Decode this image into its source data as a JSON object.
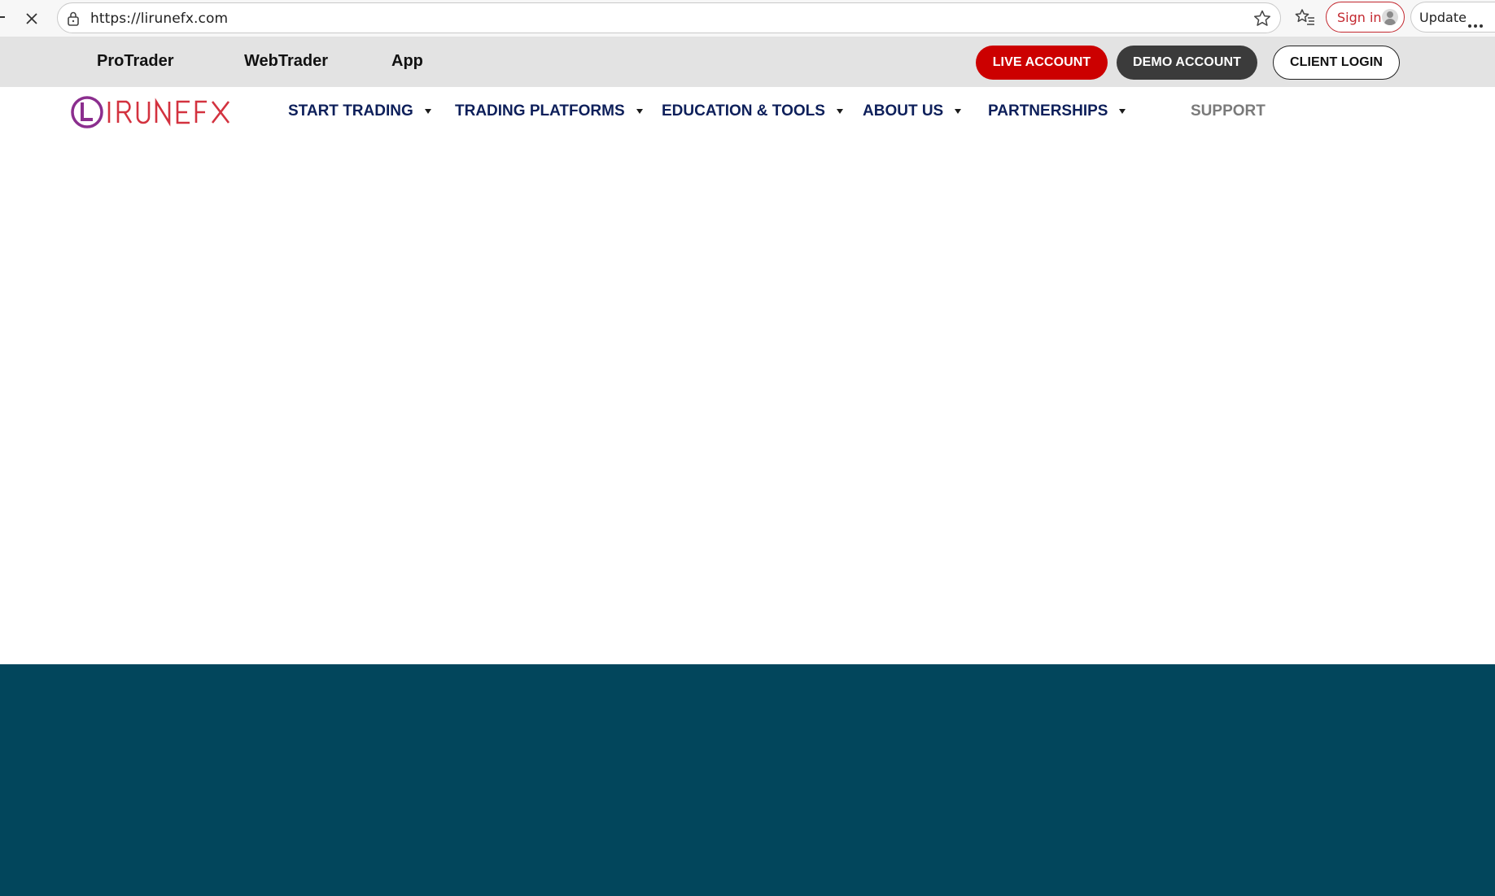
{
  "browser": {
    "url": "https://lirunefx.com",
    "sign_in_label": "Sign in",
    "update_label": "Update",
    "icons": [
      "back-icon",
      "stop-loading-icon",
      "lock-icon",
      "favorite-star-icon",
      "favorites-icon",
      "profile-avatar-icon",
      "more-options-icon"
    ]
  },
  "utility_bar": {
    "links": [
      "ProTrader",
      "WebTrader",
      "App"
    ],
    "live_account": "LIVE ACCOUNT",
    "demo_account": "DEMO ACCOUNT",
    "client_login": "CLIENT LOGIN"
  },
  "main_nav": {
    "logo_text": "LIRUNEFX",
    "items": [
      {
        "label": "START TRADING"
      },
      {
        "label": "TRADING PLATFORMS"
      },
      {
        "label": "EDUCATION & TOOLS"
      },
      {
        "label": "ABOUT US"
      },
      {
        "label": "PARTNERSHIPS"
      }
    ],
    "support": "SUPPORT"
  },
  "colors": {
    "brand_red": "#cc0000",
    "demo_dark": "#3b3b3b",
    "nav_navy": "#0d1f5a",
    "teal_section": "#02465c",
    "logo_magenta": "#8b2e8e",
    "logo_red": "#d3323f"
  }
}
